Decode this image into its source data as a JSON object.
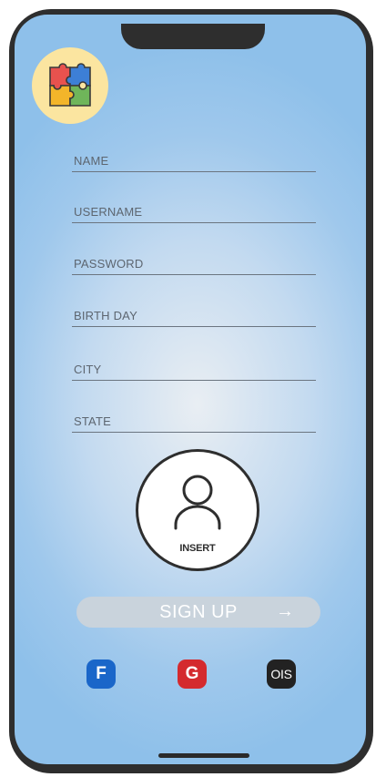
{
  "form": {
    "fields": [
      {
        "name": "name",
        "placeholder": "NAME"
      },
      {
        "name": "username",
        "placeholder": "USERNAME"
      },
      {
        "name": "password",
        "placeholder": "PASSWORD"
      },
      {
        "name": "birthday",
        "placeholder": "BIRTH DAY"
      },
      {
        "name": "city",
        "placeholder": "CITY"
      },
      {
        "name": "state",
        "placeholder": "STATE"
      }
    ]
  },
  "avatar": {
    "label": "INSERT"
  },
  "signup": {
    "label": "SIGN UP",
    "arrow": "→"
  },
  "social": {
    "facebook": "F",
    "google": "G",
    "ios": "OIS"
  },
  "colors": {
    "facebook": "#1a66c9",
    "google": "#d42a2e",
    "ios": "#222222",
    "logo_bg": "#fbe5a0",
    "signup_bg": "#c9d3dc"
  },
  "icons": {
    "logo": "puzzle-icon",
    "avatar": "user-icon",
    "arrow": "arrow-right-icon"
  }
}
